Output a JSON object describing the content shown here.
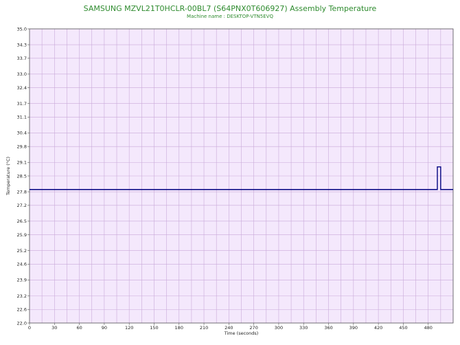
{
  "chart_data": {
    "type": "line",
    "title": "SAMSUNG MZVL21T0HCLR-00BL7 (S64PNX0T606927) Assembly Temperature",
    "subtitle": "Machine name : DESKTOP-VTN5EVQ",
    "xlabel": "Time (seconds)",
    "ylabel": "Temperature (°C)",
    "xlim": [
      0,
      510
    ],
    "ylim": [
      22.0,
      35.0
    ],
    "x_ticks": [
      0,
      30,
      60,
      90,
      120,
      150,
      180,
      210,
      240,
      270,
      300,
      330,
      360,
      390,
      420,
      450,
      480
    ],
    "y_ticks": [
      "22.0",
      "22.6",
      "23.2",
      "23.9",
      "24.6",
      "25.2",
      "25.9",
      "26.5",
      "27.2",
      "27.8",
      "28.5",
      "29.1",
      "29.8",
      "30.4",
      "31.1",
      "31.7",
      "32.4",
      "33.0",
      "33.7",
      "34.3",
      "35.0"
    ],
    "grid": true,
    "colors": {
      "plot_background": "#f4e8fc",
      "grid": "#c9a9d9",
      "line": "#000080",
      "title": "#2e8b2e"
    },
    "series": [
      {
        "x": [
          0,
          491,
          491,
          495,
          495,
          510
        ],
        "y": [
          27.9,
          27.9,
          28.9,
          28.9,
          27.9,
          27.9
        ]
      }
    ]
  }
}
